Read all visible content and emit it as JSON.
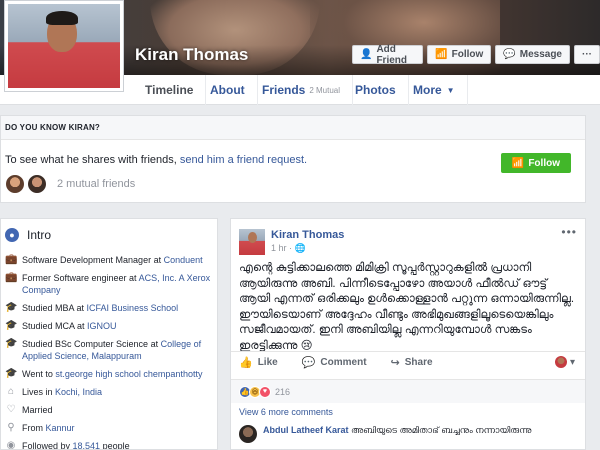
{
  "profile": {
    "name": "Kiran Thomas"
  },
  "cover_actions": [
    {
      "icon": "add-friend-icon",
      "glyph": "👤+",
      "label": "Add Friend"
    },
    {
      "icon": "rss-follow-icon",
      "glyph": "⚡",
      "label": "Follow"
    },
    {
      "icon": "messenger-icon",
      "glyph": "✉",
      "label": "Message"
    },
    {
      "icon": "more-dots-icon",
      "glyph": "",
      "label": "···"
    }
  ],
  "nav": {
    "tabs": [
      "Timeline",
      "About",
      "Friends",
      "Photos",
      "More"
    ],
    "friends_sub": "2 Mutual"
  },
  "know": {
    "heading": "DO YOU KNOW KIRAN?",
    "text_prefix": "To see what he shares with friends, ",
    "link": "send him a friend request.",
    "follow_label": "Follow",
    "mutual": "2 mutual friends"
  },
  "intro": {
    "title": "Intro",
    "items": [
      {
        "icon": "briefcase-icon",
        "text": "Software Development Manager at ",
        "link": "Conduent",
        "rest": ""
      },
      {
        "icon": "briefcase-icon",
        "text": "Former Software engineer at ",
        "link": "ACS, Inc. A Xerox Company",
        "rest": ""
      },
      {
        "icon": "graduation-cap-icon",
        "text": "Studied MBA at ",
        "link": "ICFAI Business School",
        "rest": ""
      },
      {
        "icon": "graduation-cap-icon",
        "text": "Studied MCA at ",
        "link": "IGNOU",
        "rest": ""
      },
      {
        "icon": "graduation-cap-icon",
        "text": "Studied BSc Computer Science at ",
        "link": "College of Applied Science, Malappuram",
        "rest": ""
      },
      {
        "icon": "graduation-cap-icon",
        "text": "Went to ",
        "link": "st.george high school chempanthotty",
        "rest": ""
      },
      {
        "icon": "home-icon",
        "text": "Lives in ",
        "link": "Kochi, India",
        "rest": ""
      },
      {
        "icon": "heart-icon",
        "text": "Married",
        "link": "",
        "rest": ""
      },
      {
        "icon": "location-pin-icon",
        "text": "From ",
        "link": "Kannur",
        "rest": ""
      },
      {
        "icon": "rss-icon",
        "text": "Followed by ",
        "link": "18,541",
        "rest": " people"
      }
    ]
  },
  "post": {
    "author": "Kiran Thomas",
    "time": "1 hr · ",
    "text": "എന്റെ കുട്ടിക്കാലത്തെ മിമിക്രി സൂപ്പർസ്റ്റാറുകളിൽ പ്രധാനി ആയിരുന്നു അബി. പിന്നീടെപ്പോഴോ അയാൾ ഫീൽഡ് ഔട്ട് ആയി എന്നത് ഒരിക്കലും ഉൾക്കൊള്ളാൻ പറ്റുന്ന ഒന്നായിരുന്നില്ല. ഈയിടെയാണ് അദ്ദേഹം വീണ്ടും അഭിമുഖങ്ങളിലൂടെയെങ്കിലും സജീവമായത്. ഇനി അബിയില്ല എന്നറിയുമ്പോൾ സങ്കടം ഇരട്ടിക്കുന്നു 😢",
    "actions": [
      "Like",
      "Comment",
      "Share"
    ],
    "reaction_count": "216",
    "view_comments": "View 6 more comments",
    "comment_author": "Abdul Latheef Karat",
    "comment_text": " അബിയുടെ അമിതാഭ് ബച്ചനും നന്നായിരുന്നു"
  }
}
